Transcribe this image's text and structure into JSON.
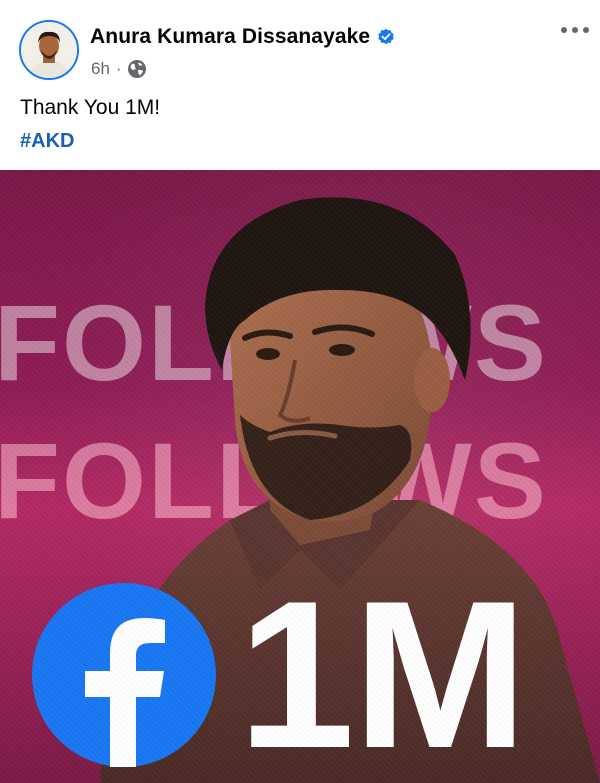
{
  "post": {
    "author": "Anura Kumara Dissanayake",
    "time": "6h",
    "separator": "·",
    "audience_icon": "globe-icon",
    "verified_icon": "verified-badge-icon",
    "more_icon": "more-options-icon",
    "caption": "Thank You 1M!",
    "hashtag": "#AKD"
  },
  "image": {
    "bg_word_1": "FOLLOWS",
    "bg_word_2": "FOLLOWS",
    "count": "1M",
    "logo_icon": "facebook-logo-icon"
  },
  "colors": {
    "brand_blue": "#1877f2",
    "hashtag": "#1a5fb4",
    "background_magenta": "#9b2258"
  }
}
